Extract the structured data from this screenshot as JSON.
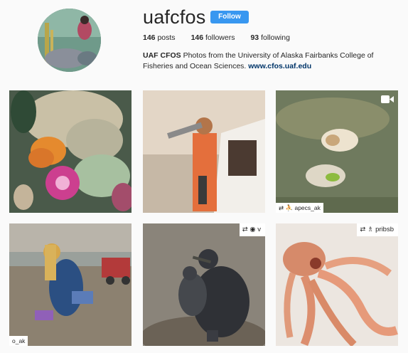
{
  "profile": {
    "username": "uafcfos",
    "follow_label": "Follow",
    "posts_count": "146",
    "posts_label": "posts",
    "followers_count": "146",
    "followers_label": "followers",
    "following_count": "93",
    "following_label": "following",
    "bio_name": "UAF CFOS",
    "bio_text": "Photos from the University of Alaska Fairbanks College of Fisheries and Ocean Sciences.",
    "bio_link": "www.cfos.uaf.edu"
  },
  "posts": [
    {
      "name": "sea-anemone-reef",
      "tag": ""
    },
    {
      "name": "fisherman-on-boat",
      "tag": ""
    },
    {
      "name": "hermit-crab-shells",
      "tag": "apecs_ak",
      "video": true
    },
    {
      "name": "scientist-on-beach",
      "tag": "o_ak"
    },
    {
      "name": "cormorant-birds",
      "tag": "v"
    },
    {
      "name": "octopus",
      "tag": "pribsb"
    }
  ],
  "colors": {
    "follow_button": "#3897f0",
    "background": "#fafafa",
    "link": "#003569"
  }
}
